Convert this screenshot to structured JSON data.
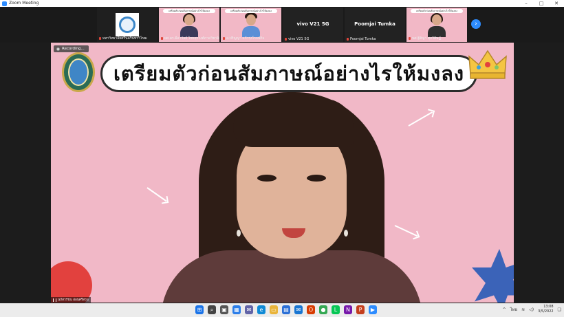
{
  "window": {
    "title": "Zoom Meeting"
  },
  "window_controls": [
    "–",
    "□",
    "✕"
  ],
  "gallery": {
    "tiles": [
      {
        "name": "มหาวิทยาลัยศรีนครินทรวิโรฒ",
        "type": "logo"
      },
      {
        "name": "ผศ.ดร.มีลาวัลย์ ไชยสุรวงศ์ภาควิชาจิต...",
        "type": "video",
        "banner": "เตรียมตัวก่อนสัมภาษณ์อย่างไรให้มงลง"
      },
      {
        "name": "อ.ปริญญา แก้วรุ่งโรจน์กิจ",
        "type": "video",
        "banner": "เตรียมตัวก่อนสัมภาษณ์อย่างไรให้มงลง"
      },
      {
        "name": "vivo V21 5G",
        "type": "name"
      },
      {
        "name": "Poomjai Tumka",
        "type": "name"
      },
      {
        "name": "นศ.ฐิติญา ศุภวิศิษฏ์",
        "type": "video",
        "banner": "เตรียมตัวก่อนสัมภาษณ์อย่างไรให้มงลง"
      }
    ],
    "next_icon": "›"
  },
  "stage": {
    "recording_label": "Recording...",
    "headline": "เตรียมตัวก่อนสัมภาษณ์อย่างไรให้มงลง",
    "speaker_name": "นภัสวรรณ อ่อนศรีสวน"
  },
  "taskbar": {
    "icons": [
      {
        "name": "start-icon",
        "glyph": "⊞",
        "color": "#1a73e8"
      },
      {
        "name": "search-icon",
        "glyph": "⌕",
        "color": "#444444"
      },
      {
        "name": "task-view-icon",
        "glyph": "▣",
        "color": "#555555"
      },
      {
        "name": "widgets-icon",
        "glyph": "▦",
        "color": "#2b7de9"
      },
      {
        "name": "chat-icon",
        "glyph": "✉",
        "color": "#6264a7"
      },
      {
        "name": "edge-icon",
        "glyph": "e",
        "color": "#0f8ad6"
      },
      {
        "name": "file-explorer-icon",
        "glyph": "▭",
        "color": "#e9b43a"
      },
      {
        "name": "store-icon",
        "glyph": "▤",
        "color": "#2a6fd6"
      },
      {
        "name": "mail-icon",
        "glyph": "✉",
        "color": "#1976d2"
      },
      {
        "name": "office-icon",
        "glyph": "O",
        "color": "#d83b01"
      },
      {
        "name": "chrome-icon",
        "glyph": "●",
        "color": "#34a853"
      },
      {
        "name": "line-icon",
        "glyph": "L",
        "color": "#06c755"
      },
      {
        "name": "onenote-icon",
        "glyph": "N",
        "color": "#7719aa"
      },
      {
        "name": "powerpoint-icon",
        "glyph": "P",
        "color": "#c43e1c"
      },
      {
        "name": "zoom-icon",
        "glyph": "▶",
        "color": "#2d8cff"
      }
    ],
    "tray": {
      "chevron": "^",
      "language": "ไทย",
      "time": "13:08",
      "date": "3/5/2022"
    }
  }
}
